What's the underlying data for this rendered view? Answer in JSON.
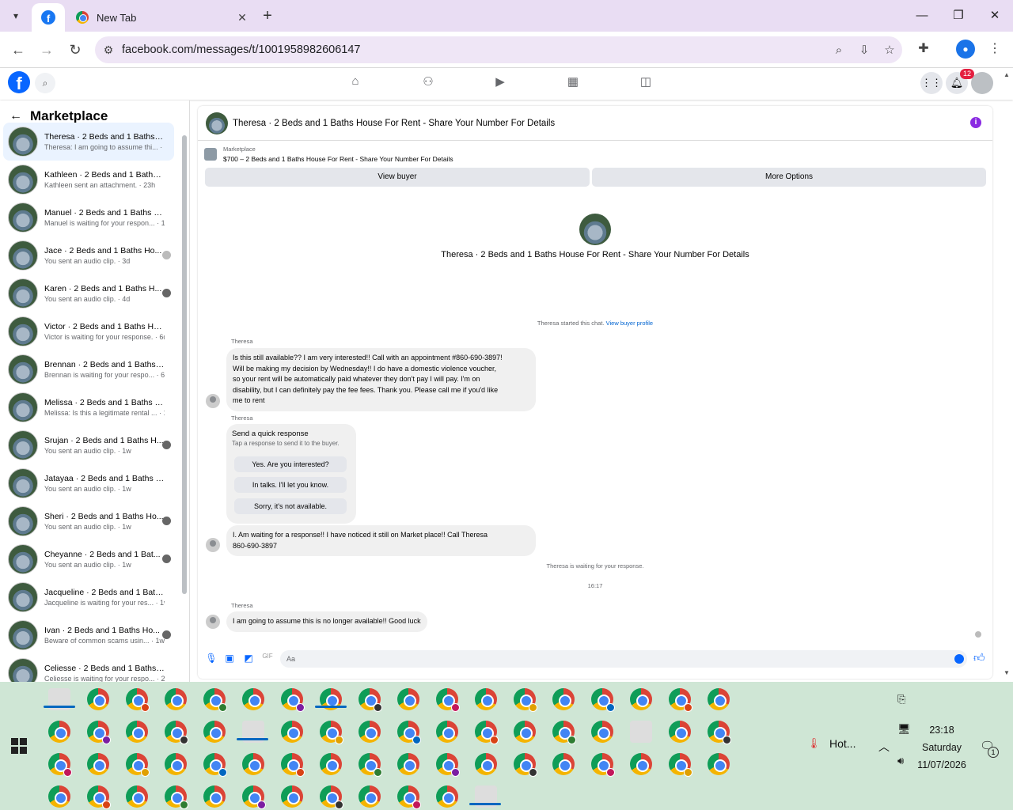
{
  "browser": {
    "tabs": [
      {
        "label": "",
        "icon": "facebook-icon",
        "active": true
      },
      {
        "label": "New Tab",
        "icon": "chrome-icon",
        "active": false
      }
    ],
    "url": "facebook.com/messages/t/1001958982606147"
  },
  "facebook": {
    "notification_count": "12",
    "sidebar_title": "Marketplace",
    "conversations": [
      {
        "name": "Theresa · 2 Beds and 1 Baths H...",
        "preview": "Theresa: I am going to assume thi... · 7h",
        "selected": true
      },
      {
        "name": "Kathleen · 2 Beds and 1 Baths H...",
        "preview": "Kathleen sent an attachment. · 23h"
      },
      {
        "name": "Manuel · 2 Beds and 1 Baths H...",
        "preview": "Manuel is waiting for your respon... · 1d"
      },
      {
        "name": "Jace · 2 Beds and 1 Baths Ho...",
        "preview": "You sent an audio clip. · 3d"
      },
      {
        "name": "Karen · 2 Beds and 1 Baths H...",
        "preview": "You sent an audio clip. · 4d"
      },
      {
        "name": "Victor · 2 Beds and 1 Baths Hou...",
        "preview": "Victor is waiting for your response. · 6d"
      },
      {
        "name": "Brennan · 2 Beds and 1 Baths H...",
        "preview": "Brennan is waiting for your respo... · 6d"
      },
      {
        "name": "Melissa · 2 Beds and 1 Baths Ho...",
        "preview": "Melissa: Is this a legitimate rental ... · 1w"
      },
      {
        "name": "Srujan · 2 Beds and 1 Baths H...",
        "preview": "You sent an audio clip. · 1w"
      },
      {
        "name": "Jatayaa · 2 Beds and 1 Baths Ho...",
        "preview": "You sent an audio clip. · 1w"
      },
      {
        "name": "Sheri · 2 Beds and 1 Baths Ho...",
        "preview": "You sent an audio clip. · 1w"
      },
      {
        "name": "Cheyanne · 2 Beds and 1 Bat...",
        "preview": "You sent an audio clip. · 1w"
      },
      {
        "name": "Jacqueline · 2 Beds and 1 Baths...",
        "preview": "Jacqueline is waiting for your res... · 1w"
      },
      {
        "name": "Ivan · 2 Beds and 1 Baths Ho...",
        "preview": "Beware of common scams usin... · 1w"
      },
      {
        "name": "Celiesse · 2 Beds and 1 Baths H...",
        "preview": "Celiesse is waiting for your respo... · 2w"
      }
    ],
    "chat": {
      "title": "Theresa · 2 Beds and 1 Baths House For Rent - Share Your Number For Details",
      "listing_source": "Marketplace",
      "listing_title": "$700 – 2 Beds and 1 Baths House For Rent - Share Your Number For Details",
      "view_buyer": "View buyer",
      "more_options": "More Options",
      "started_text": "Theresa started this chat.",
      "view_profile": "View buyer profile",
      "sender": "Theresa",
      "message1": "Is this still available?? I am very interested!! Call with an appointment #860-690-3897!\nWill be making my decision by Wednesday!! I do have a domestic violence voucher,\nso your rent will be automatically paid whatever they don't pay I will pay. I'm on\ndisability, but I can definitely pay the fee fees. Thank you. Please call me if you'd like\nme to rent",
      "quick_title": "Send a quick response",
      "quick_sub": "Tap a response to send it to the buyer.",
      "quick_options": [
        "Yes. Are you interested?",
        "In talks. I'll let you know.",
        "Sorry, it's not available."
      ],
      "message2": "I. Am waiting for a response!! I have noticed it still on Market place!! Call  Theresa\n860-690-3897",
      "waiting": "Theresa is waiting for your response.",
      "time": "16:17",
      "message3": "I am going to assume this is no longer available!! Good luck",
      "compose_placeholder": "Aa"
    }
  },
  "taskbar": {
    "weather": "Hot...",
    "time": "23:18",
    "day": "Saturday",
    "date": "11/07/2026",
    "notification_count": "1"
  }
}
